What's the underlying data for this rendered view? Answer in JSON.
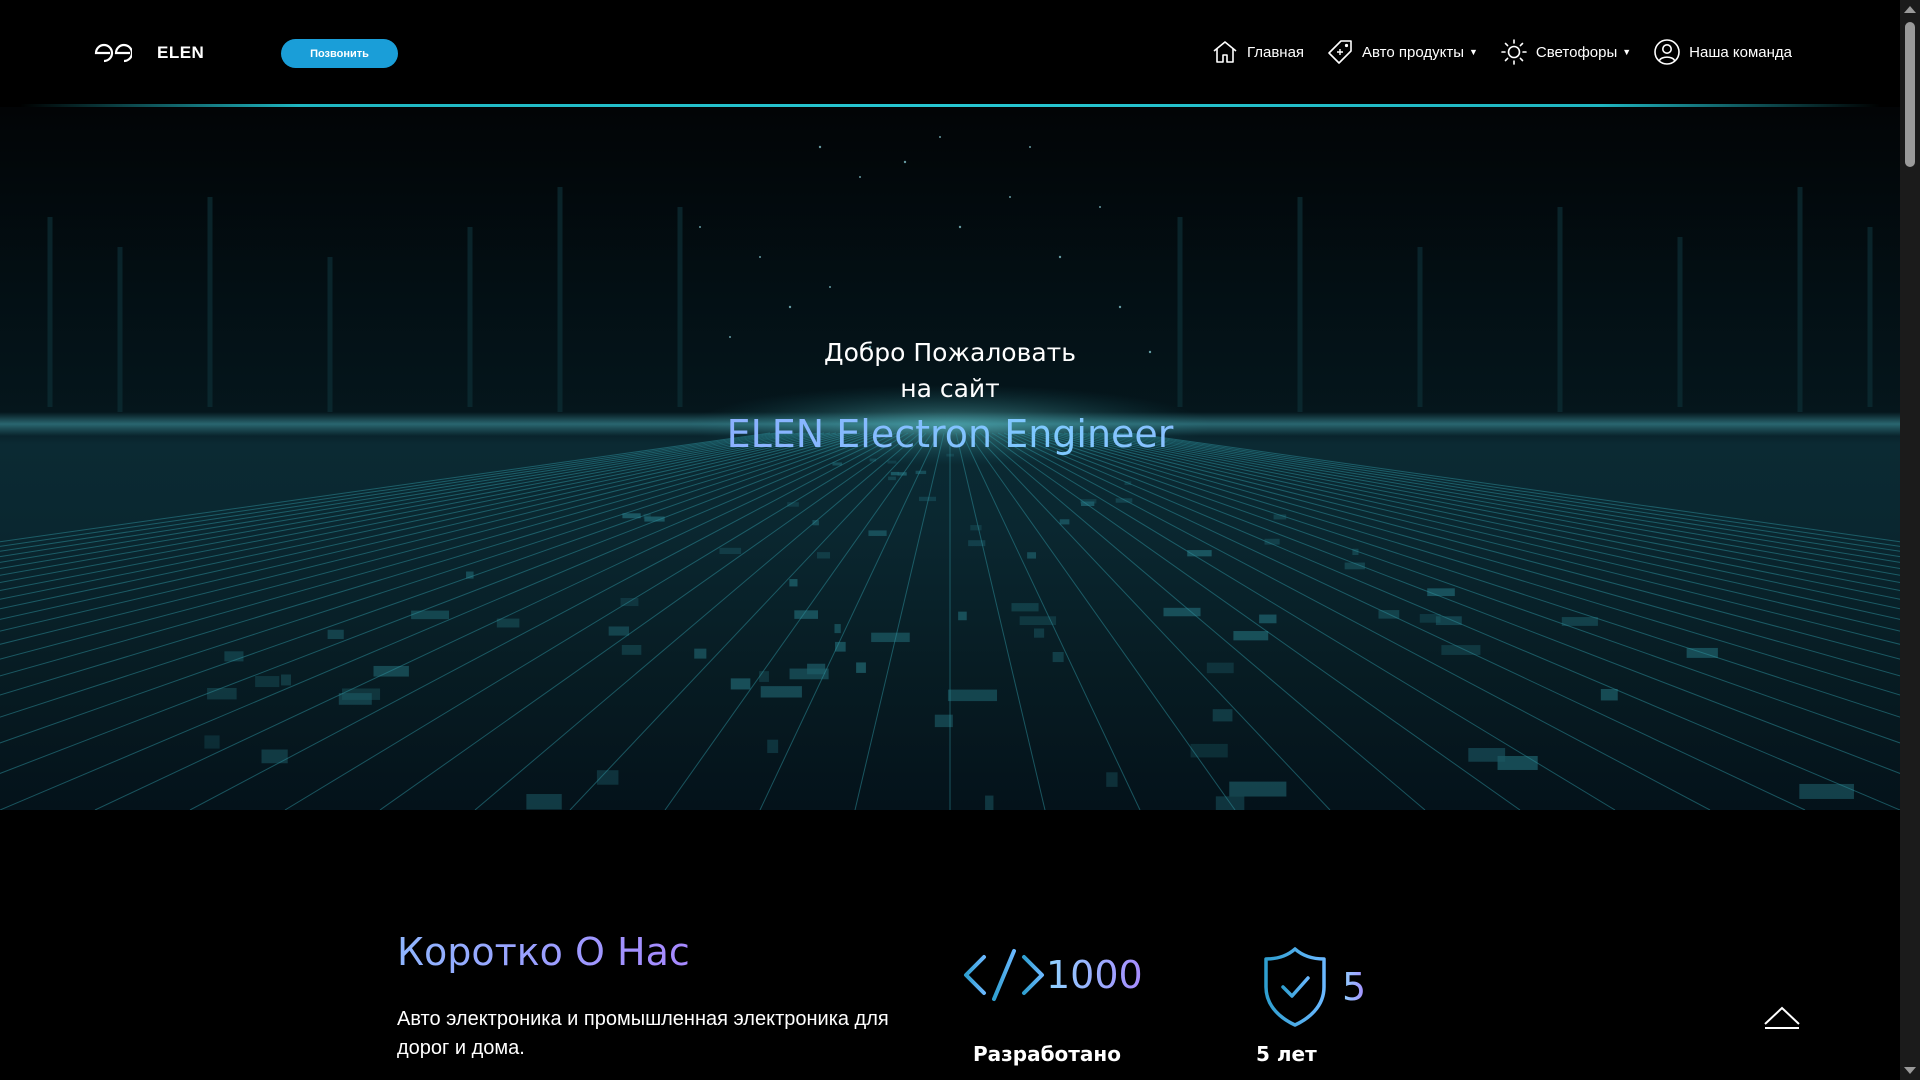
{
  "header": {
    "brand": "ELEN",
    "call_button": "Позвонить",
    "nav": [
      {
        "label": "Главная",
        "icon": "home-icon",
        "has_dropdown": false
      },
      {
        "label": "Авто продукты",
        "icon": "tag-icon",
        "has_dropdown": true
      },
      {
        "label": "Светофоры",
        "icon": "sun-icon",
        "has_dropdown": true
      },
      {
        "label": "Наша команда",
        "icon": "user-icon",
        "has_dropdown": false
      }
    ]
  },
  "hero": {
    "line1": "Добро Пожаловать",
    "line2": "на сайт",
    "title": "ELEN Electron Engineer"
  },
  "about": {
    "title": "Коротко О Нас",
    "text": "Авто электроника и промышленная электроника для дорог и дома.",
    "stats": [
      {
        "icon": "code-icon",
        "value": "1000",
        "label": "Разработано"
      },
      {
        "icon": "shield-check-icon",
        "value": "5",
        "label": "5 лет"
      }
    ]
  },
  "colors": {
    "accent": "#1a9ed8",
    "line": "#27c7d2",
    "gradient_start": "#a978ff",
    "gradient_end": "#7ec9ff"
  }
}
